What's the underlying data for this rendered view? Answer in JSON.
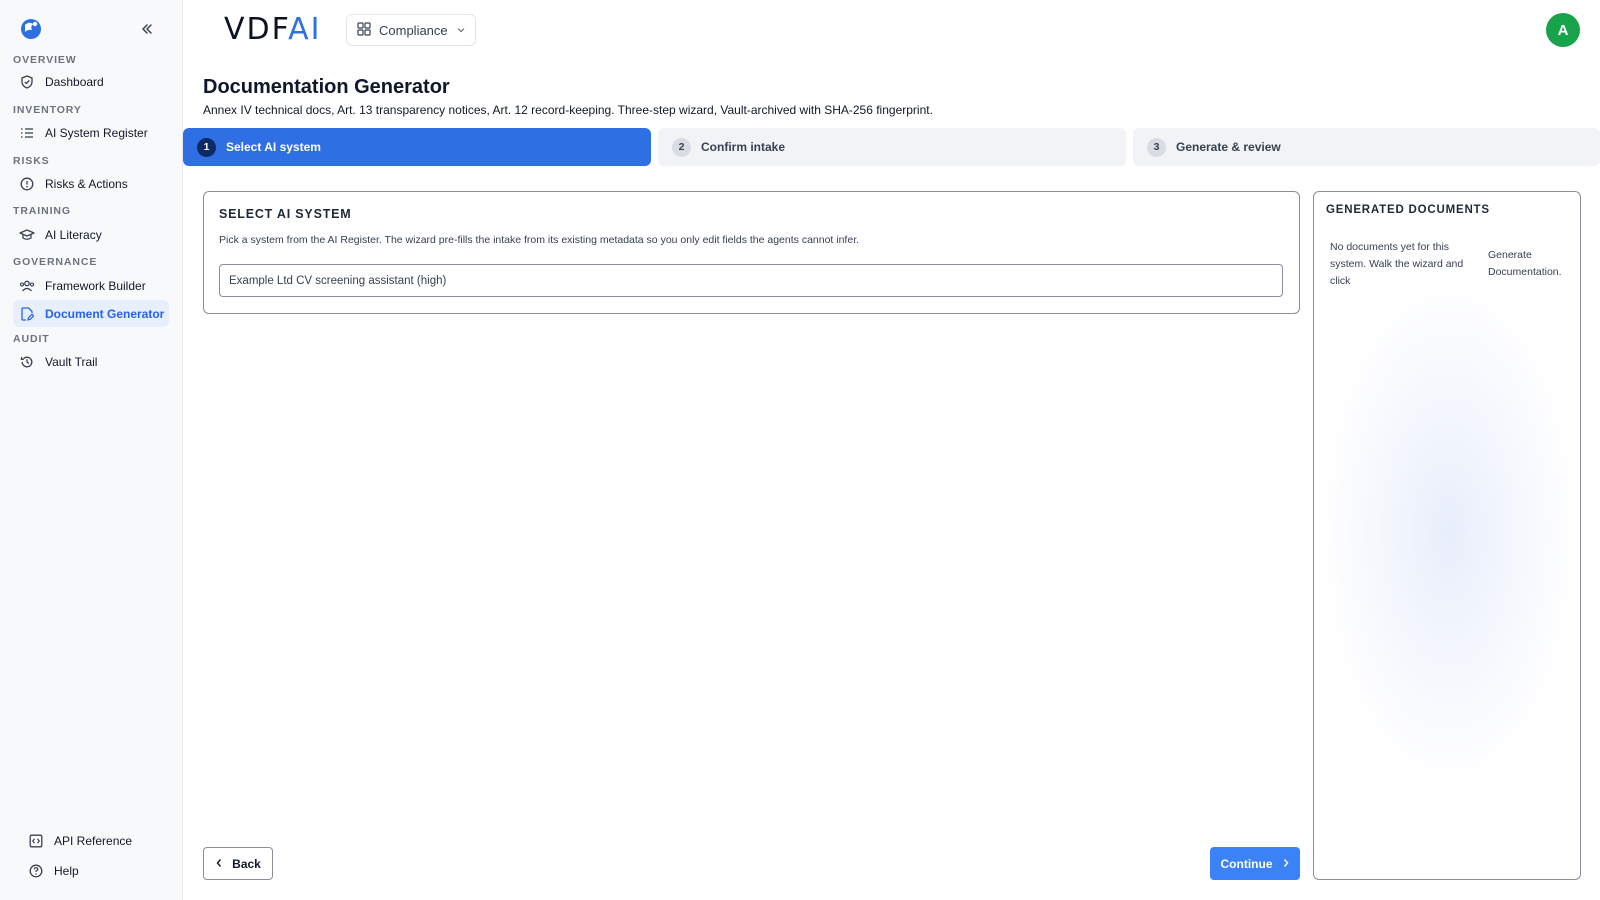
{
  "app": {
    "logo_main": "VDF",
    "logo_ai": "AI",
    "org_selector": "Compliance",
    "avatar_initial": "A"
  },
  "sidebar": {
    "sections": [
      {
        "title": "OVERVIEW",
        "items": [
          {
            "label": "Dashboard",
            "icon": "shield-check-icon"
          }
        ]
      },
      {
        "title": "INVENTORY",
        "items": [
          {
            "label": "AI System Register",
            "icon": "list-icon"
          }
        ]
      },
      {
        "title": "RISKS",
        "items": [
          {
            "label": "Risks & Actions",
            "icon": "alert-circle-icon"
          }
        ]
      },
      {
        "title": "TRAINING",
        "items": [
          {
            "label": "AI Literacy",
            "icon": "graduation-cap-icon"
          }
        ]
      },
      {
        "title": "GOVERNANCE",
        "items": [
          {
            "label": "Framework Builder",
            "icon": "users-icon"
          },
          {
            "label": "Document Generator",
            "icon": "file-edit-icon",
            "active": true
          }
        ]
      },
      {
        "title": "AUDIT",
        "items": [
          {
            "label": "Vault Trail",
            "icon": "history-icon"
          }
        ]
      }
    ],
    "footer": [
      {
        "label": "API Reference",
        "icon": "code-square-icon"
      },
      {
        "label": "Help",
        "icon": "help-circle-icon"
      }
    ]
  },
  "page": {
    "title": "Documentation Generator",
    "subtitle": "Annex IV technical docs, Art. 13 transparency notices, Art. 12 record-keeping. Three-step wizard, Vault-archived with SHA-256 fingerprint."
  },
  "steps": [
    {
      "number": "1",
      "label": "Select AI system",
      "active": true
    },
    {
      "number": "2",
      "label": "Confirm intake",
      "active": false
    },
    {
      "number": "3",
      "label": "Generate & review",
      "active": false
    }
  ],
  "select_card": {
    "title": "SELECT AI SYSTEM",
    "description": "Pick a system from the AI Register. The wizard pre-fills the intake from its existing metadata so you only edit fields the agents cannot infer.",
    "selected_value": "Example Ltd CV screening assistant (high)"
  },
  "docs_panel": {
    "title": "GENERATED DOCUMENTS",
    "empty_text": "No documents yet for this system. Walk the wizard and click",
    "cta_text": "Generate Documentation",
    "cta_suffix": "."
  },
  "buttons": {
    "back": "Back",
    "continue": "Continue"
  },
  "colors": {
    "accent": "#2f6fe4",
    "continue": "#3b82f6",
    "avatar": "#16a34a",
    "active_nav_bg": "#e8effc"
  }
}
